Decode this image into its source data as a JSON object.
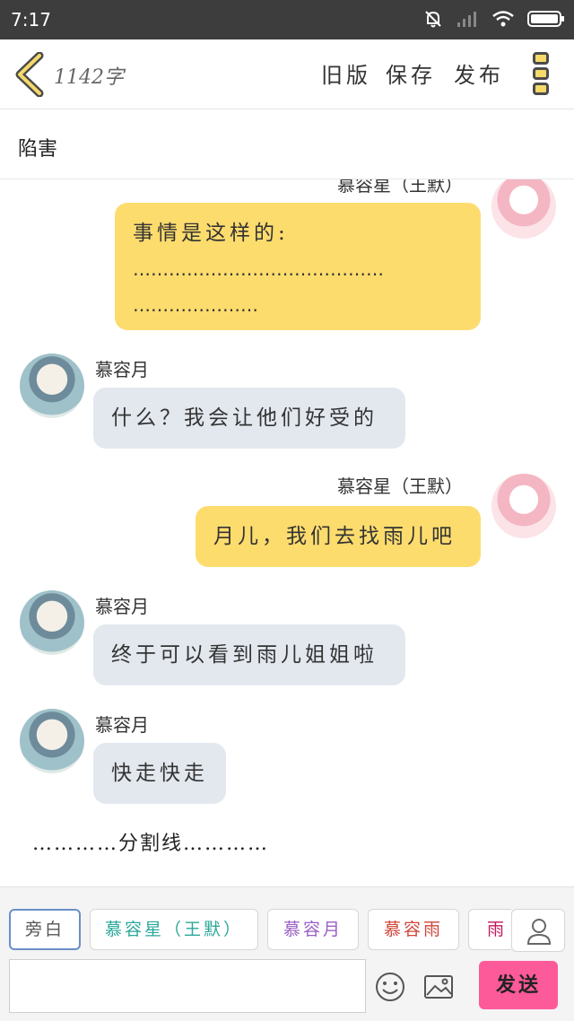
{
  "status_bar": {
    "time": "7:17",
    "icons": [
      "bell-muted-icon",
      "signal-icon",
      "wifi-icon",
      "battery-icon"
    ]
  },
  "header": {
    "word_count": "1142字",
    "old_version_label": "旧版",
    "save_label": "保存",
    "publish_label": "发布",
    "accent_color": "#f5d96a"
  },
  "title": "陷害",
  "messages": [
    {
      "speaker": "慕容星（王默）",
      "side": "right",
      "lines": [
        "事情是这样的:",
        "……………………………………",
        "…………………"
      ]
    },
    {
      "speaker": "慕容月",
      "side": "left",
      "text": "什么？我会让他们好受的"
    },
    {
      "speaker": "慕容星（王默）",
      "side": "right",
      "text": "月儿，我们去找雨儿吧"
    },
    {
      "speaker": "慕容月",
      "side": "left",
      "text": "终于可以看到雨儿姐姐啦"
    },
    {
      "speaker": "慕容月",
      "side": "left",
      "text": "快走快走"
    }
  ],
  "divider_text": "…………分割线…………",
  "roles": [
    {
      "label": "旁白",
      "color": "#555555"
    },
    {
      "label": "慕容星（王默）",
      "color": "#2aa89a"
    },
    {
      "label": "慕容月",
      "color": "#9a5fc4"
    },
    {
      "label": "慕容雨",
      "color": "#d0453a"
    },
    {
      "label": "雨",
      "color": "#c2185b"
    }
  ],
  "input_placeholder": "",
  "send_label": "发送",
  "colors": {
    "yellow_bubble": "#fddc6e",
    "grey_bubble": "#e3e8ef",
    "send_button": "#fd5a9a"
  }
}
